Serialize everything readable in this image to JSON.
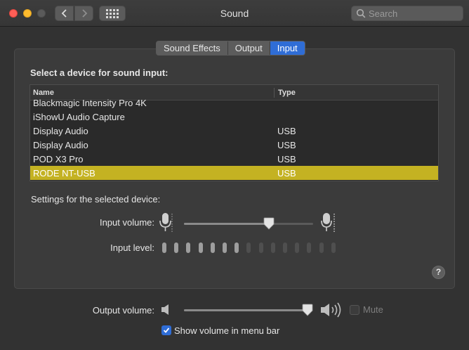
{
  "window": {
    "title": "Sound"
  },
  "search": {
    "placeholder": "Search"
  },
  "tabs": [
    {
      "label": "Sound Effects",
      "active": false
    },
    {
      "label": "Output",
      "active": false
    },
    {
      "label": "Input",
      "active": true
    }
  ],
  "input": {
    "section_title": "Select a device for sound input:",
    "columns": {
      "name": "Name",
      "type": "Type"
    },
    "devices": [
      {
        "name": "Blackmagic Intensity Pro 4K",
        "type": ""
      },
      {
        "name": "iShowU Audio Capture",
        "type": ""
      },
      {
        "name": "Display Audio",
        "type": "USB"
      },
      {
        "name": "Display Audio",
        "type": "USB"
      },
      {
        "name": "POD X3 Pro",
        "type": "USB"
      },
      {
        "name": "RODE NT-USB",
        "type": "USB",
        "selected": true
      }
    ],
    "settings_title": "Settings for the selected device:",
    "input_volume_label": "Input volume:",
    "input_volume_fraction": 0.66,
    "input_level_label": "Input level:",
    "input_level_lit": 7,
    "input_level_total": 15
  },
  "output": {
    "volume_label": "Output volume:",
    "volume_fraction": 1.0,
    "mute_label": "Mute",
    "mute_checked": false,
    "show_in_menu_bar_label": "Show volume in menu bar",
    "show_in_menu_bar_checked": true
  },
  "help": {
    "label": "?"
  },
  "colors": {
    "accent": "#2f6dd6",
    "selected_row": "#c4b222",
    "close": "#fe5f57",
    "minimize": "#febc2e"
  }
}
